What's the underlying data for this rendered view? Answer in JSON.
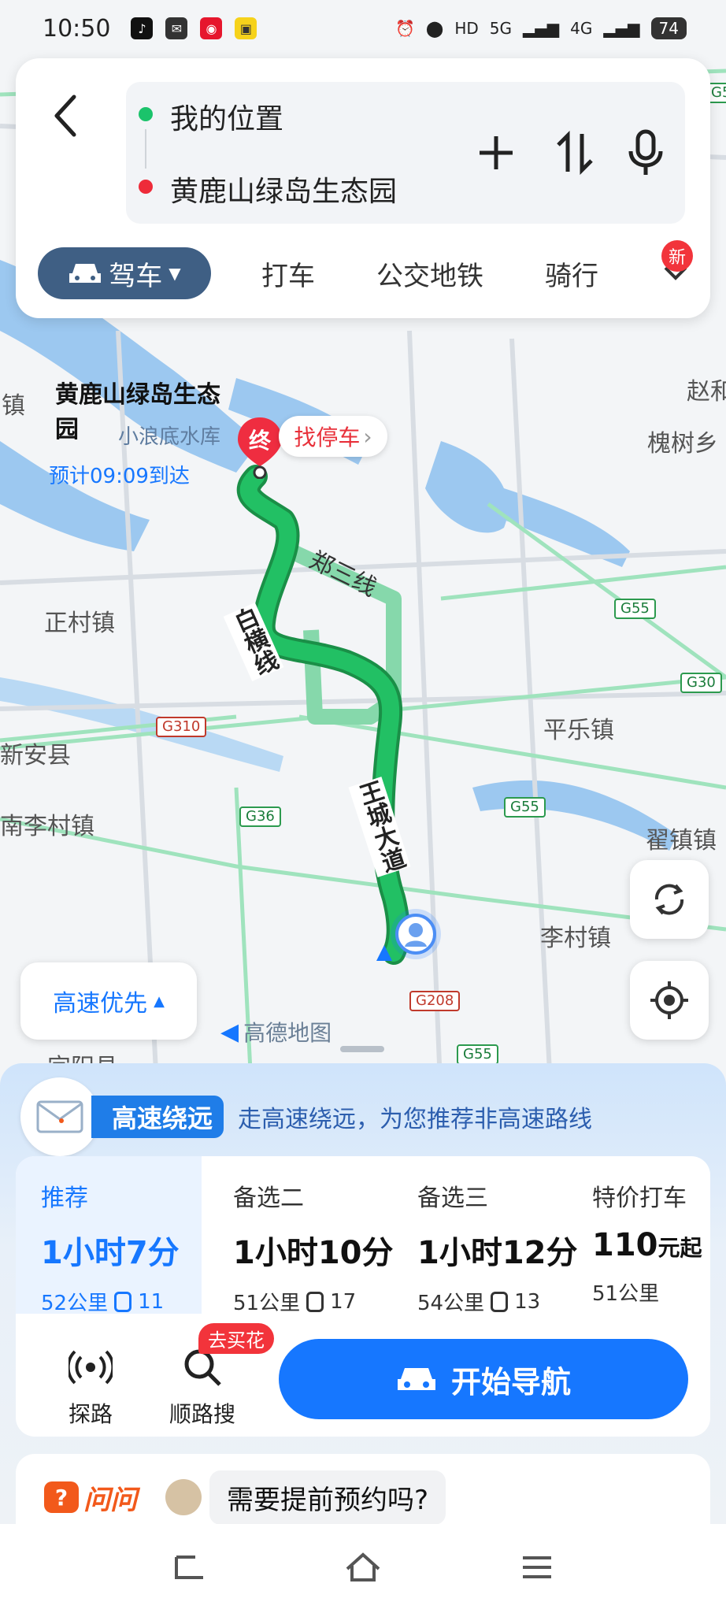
{
  "status_bar": {
    "time": "10:50",
    "network_1": "5G",
    "network_2": "4G",
    "battery": "74"
  },
  "search": {
    "origin": "我的位置",
    "destination": "黄鹿山绿岛生态园"
  },
  "modes": {
    "active": "驾车",
    "items": [
      "打车",
      "公交地铁",
      "骑行"
    ],
    "new_badge": "新"
  },
  "map": {
    "labels": [
      "赵和",
      "槐树乡",
      "镇",
      "正村镇",
      "新安县",
      "南李村镇",
      "平乐镇",
      "翟镇镇",
      "李村镇",
      "宜阳县",
      "小浪底水库"
    ],
    "road_names": [
      "郑三线",
      "白横线",
      "王城大道"
    ],
    "shields": [
      "G55",
      "G55",
      "G30",
      "G310",
      "G36",
      "G55",
      "G208",
      "G55"
    ],
    "destination_title": "黄鹿山绿岛生态园",
    "eta": "预计09:09到达",
    "end_marker": "终",
    "parking": "找停车",
    "route_color": "#1fb25a",
    "alt_route_color": "#7fd6a4"
  },
  "map_controls": {
    "preference": "高速优先",
    "logo": "高德地图"
  },
  "hint": {
    "tag": "高速绕远",
    "text": "走高速绕远，为您推荐非高速路线"
  },
  "routes": [
    {
      "name": "推荐",
      "time": "1小时7分",
      "distance": "52公里",
      "lights": "11"
    },
    {
      "name": "备选二",
      "time": "1小时10分",
      "distance": "51公里",
      "lights": "17"
    },
    {
      "name": "备选三",
      "time": "1小时12分",
      "distance": "54公里",
      "lights": "13"
    },
    {
      "name": "特价打车",
      "price": "110",
      "price_unit": "元起",
      "distance": "51公里"
    }
  ],
  "actions": {
    "explore": "探路",
    "along_search": "顺路搜",
    "flower_badge": "去买花",
    "start_nav": "开始导航"
  },
  "ask": {
    "logo": "问问",
    "question": "需要提前预约吗?"
  },
  "accent": "#1677ff"
}
